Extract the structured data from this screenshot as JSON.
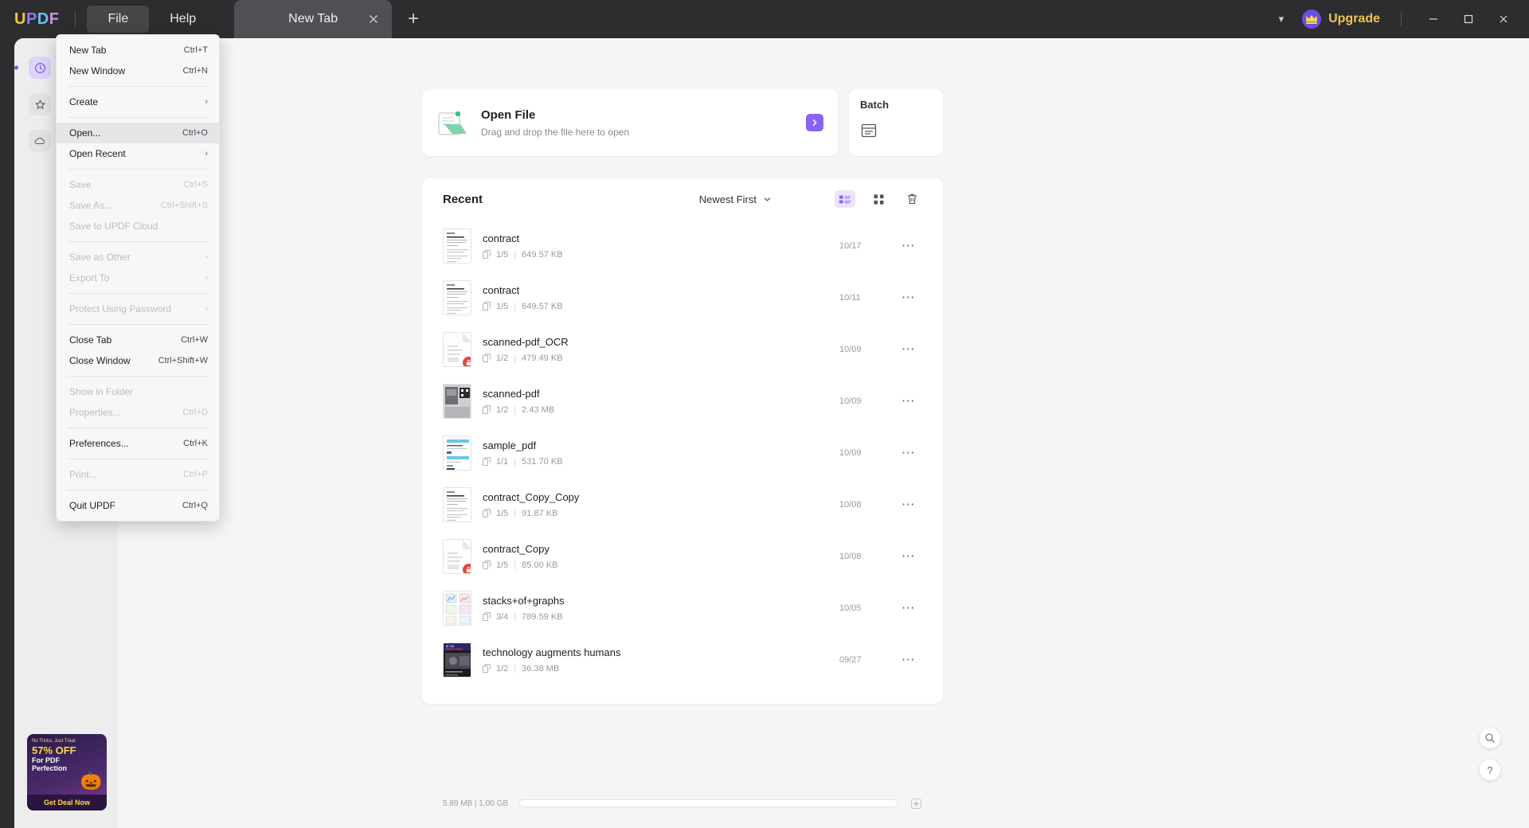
{
  "app": {
    "logo": "UPDF",
    "logo_letters": [
      "U",
      "P",
      "D",
      "F"
    ]
  },
  "titlebar": {
    "menus": [
      {
        "label": "File",
        "active": true
      },
      {
        "label": "Help",
        "active": false
      }
    ],
    "tab": {
      "label": "New Tab",
      "close_icon": "close-icon"
    },
    "new_tab_icon": "plus-icon",
    "chevron_icon": "chevron-down-icon",
    "upgrade_label": "Upgrade",
    "upgrade_icon": "crown-icon",
    "window_buttons": {
      "minimize": "minimize-icon",
      "maximize": "maximize-icon",
      "close": "close-icon"
    },
    "accent_gold": "#f0c64a"
  },
  "file_menu": {
    "items": [
      {
        "label": "New Tab",
        "shortcut": "Ctrl+T",
        "disabled": false,
        "highlight": false,
        "submenu": false
      },
      {
        "label": "New Window",
        "shortcut": "Ctrl+N",
        "disabled": false,
        "highlight": false,
        "submenu": false
      },
      {
        "sep": true
      },
      {
        "label": "Create",
        "shortcut": "",
        "disabled": false,
        "highlight": false,
        "submenu": true
      },
      {
        "sep": true
      },
      {
        "label": "Open...",
        "shortcut": "Ctrl+O",
        "disabled": false,
        "highlight": true,
        "submenu": false
      },
      {
        "label": "Open Recent",
        "shortcut": "",
        "disabled": false,
        "highlight": false,
        "submenu": true
      },
      {
        "sep": true
      },
      {
        "label": "Save",
        "shortcut": "Ctrl+S",
        "disabled": true,
        "highlight": false,
        "submenu": false
      },
      {
        "label": "Save As...",
        "shortcut": "Ctrl+Shift+S",
        "disabled": true,
        "highlight": false,
        "submenu": false
      },
      {
        "label": "Save to UPDF Cloud",
        "shortcut": "",
        "disabled": true,
        "highlight": false,
        "submenu": false
      },
      {
        "sep": true
      },
      {
        "label": "Save as Other",
        "shortcut": "",
        "disabled": true,
        "highlight": false,
        "submenu": true
      },
      {
        "label": "Export To",
        "shortcut": "",
        "disabled": true,
        "highlight": false,
        "submenu": true
      },
      {
        "sep": true
      },
      {
        "label": "Protect Using Password",
        "shortcut": "",
        "disabled": true,
        "highlight": false,
        "submenu": true
      },
      {
        "sep": true
      },
      {
        "label": "Close Tab",
        "shortcut": "Ctrl+W",
        "disabled": false,
        "highlight": false,
        "submenu": false
      },
      {
        "label": "Close Window",
        "shortcut": "Ctrl+Shift+W",
        "disabled": false,
        "highlight": false,
        "submenu": false
      },
      {
        "sep": true
      },
      {
        "label": "Show in Folder",
        "shortcut": "",
        "disabled": true,
        "highlight": false,
        "submenu": false
      },
      {
        "label": "Properties...",
        "shortcut": "Ctrl+D",
        "disabled": true,
        "highlight": false,
        "submenu": false
      },
      {
        "sep": true
      },
      {
        "label": "Preferences...",
        "shortcut": "Ctrl+K",
        "disabled": false,
        "highlight": false,
        "submenu": false
      },
      {
        "sep": true
      },
      {
        "label": "Print...",
        "shortcut": "Ctrl+P",
        "disabled": true,
        "highlight": false,
        "submenu": false
      },
      {
        "sep": true
      },
      {
        "label": "Quit UPDF",
        "shortcut": "Ctrl+Q",
        "disabled": false,
        "highlight": false,
        "submenu": false
      }
    ]
  },
  "sidebar": {
    "items": [
      {
        "label": "Recent",
        "icon": "clock-icon",
        "active": true
      },
      {
        "label": "Starred",
        "icon": "star-icon",
        "active": false
      },
      {
        "label": "UPDF Cloud",
        "icon": "cloud-icon",
        "active": false
      }
    ],
    "active_color": "#7a4cf0",
    "promo": {
      "line1": "No Tricks, Just Treat",
      "line2": "57% OFF",
      "line3": "For PDF",
      "line4": "Perfection",
      "cta": "Get Deal Now"
    }
  },
  "main": {
    "open_file_card": {
      "title": "Open File",
      "subtitle": "Drag and drop the file here to open",
      "icon": "folder-open-icon",
      "arrow_icon": "chevron-right-icon",
      "arrow_color": "#8b63f5"
    },
    "batch_card": {
      "title": "Batch",
      "icon": "batch-icon"
    },
    "recent": {
      "title": "Recent",
      "sort_label": "Newest First",
      "sort_icon": "chevron-down-icon",
      "view_list_icon": "list-view-icon",
      "view_grid_icon": "grid-view-icon",
      "delete_icon": "trash-icon",
      "active_view": "list",
      "files": [
        {
          "name": "contract",
          "pages": "1/5",
          "size": "649.57 KB",
          "date": "10/17",
          "thumb": "doc-text",
          "locked": false
        },
        {
          "name": "contract",
          "pages": "1/5",
          "size": "649.57 KB",
          "date": "10/11",
          "thumb": "doc-text",
          "locked": false
        },
        {
          "name": "scanned-pdf_OCR",
          "pages": "1/2",
          "size": "479.49 KB",
          "date": "10/09",
          "thumb": "doc-blank",
          "locked": true
        },
        {
          "name": "scanned-pdf",
          "pages": "1/2",
          "size": "2.43 MB",
          "date": "10/09",
          "thumb": "doc-photo",
          "locked": false
        },
        {
          "name": "sample_pdf",
          "pages": "1/1",
          "size": "531.70 KB",
          "date": "10/09",
          "thumb": "doc-blue",
          "locked": false
        },
        {
          "name": "contract_Copy_Copy",
          "pages": "1/5",
          "size": "91.87 KB",
          "date": "10/08",
          "thumb": "doc-text",
          "locked": false
        },
        {
          "name": "contract_Copy",
          "pages": "1/5",
          "size": "85.00 KB",
          "date": "10/08",
          "thumb": "doc-blank",
          "locked": true
        },
        {
          "name": "stacks+of+graphs",
          "pages": "3/4",
          "size": "789.59 KB",
          "date": "10/05",
          "thumb": "doc-chart",
          "locked": false
        },
        {
          "name": "technology augments humans",
          "pages": "1/2",
          "size": "36.38 MB",
          "date": "09/27",
          "thumb": "doc-dark",
          "locked": false
        }
      ],
      "row_menu_icon": "more-options-icon"
    },
    "footer": {
      "storage": "5.89 MB | 1.00 GB",
      "progress_percent": 0,
      "add_icon": "plus-icon"
    },
    "fabs": [
      {
        "icon": "search-icon"
      },
      {
        "icon": "help-icon",
        "label": "?"
      }
    ]
  }
}
